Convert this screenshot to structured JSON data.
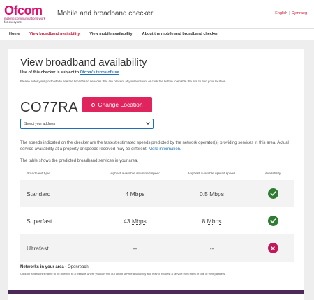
{
  "header": {
    "logo_word": "Ofcom",
    "logo_tag1": "making communications work",
    "logo_tag2": "for everyone",
    "app_title": "Mobile and broadband checker",
    "lang_english": "English",
    "lang_welsh": "Cymraeg"
  },
  "nav": {
    "items": [
      "Home",
      "View broadband availability",
      "View mobile availability",
      "About the mobile and broadband checker"
    ]
  },
  "main": {
    "title": "View broadband availability",
    "terms_prefix": "Use of this checker is subject to",
    "terms_link": "Ofcom's terms of use",
    "instructions": "Please enter your postcode to see the broadband services that are present at your location, or click the button to enable the site to find your location",
    "postcode": "CO77RA",
    "change_location_label": "Change Location",
    "address_select": "Select your address",
    "description": "The speeds indicated on the checker are the fastest estimated speeds predicted by the network operator(s) providing services in this area. Actual service availability at a property or speeds received may be different.",
    "more_info_link": "More information",
    "table_intro": "The table shows the predicted broadband services in your area."
  },
  "table": {
    "headers": [
      "Broadband type",
      "Highest available download speed",
      "Highest available upload speed",
      "Availability"
    ],
    "rows": [
      {
        "type": "Standard",
        "download": "4",
        "download_unit": "Mbps",
        "upload": "0.5",
        "upload_unit": "Mbps",
        "available": true
      },
      {
        "type": "Superfast",
        "download": "43",
        "download_unit": "Mbps",
        "upload": "8",
        "upload_unit": "Mbps",
        "available": true
      },
      {
        "type": "Ultrafast",
        "download": "--",
        "download_unit": "",
        "upload": "--",
        "upload_unit": "",
        "available": false
      }
    ]
  },
  "networks": {
    "label": "Networks in your area -",
    "link": "Openreach",
    "note": "Click on a network's name to be directed to a website where you can find out about service availability and how to request a service from them or one of their partners."
  },
  "colors": {
    "brand": "#e10e6e",
    "button": "#e0245e",
    "available": "#2e7d32",
    "unavailable": "#c2185b",
    "link": "#1d70b8"
  }
}
